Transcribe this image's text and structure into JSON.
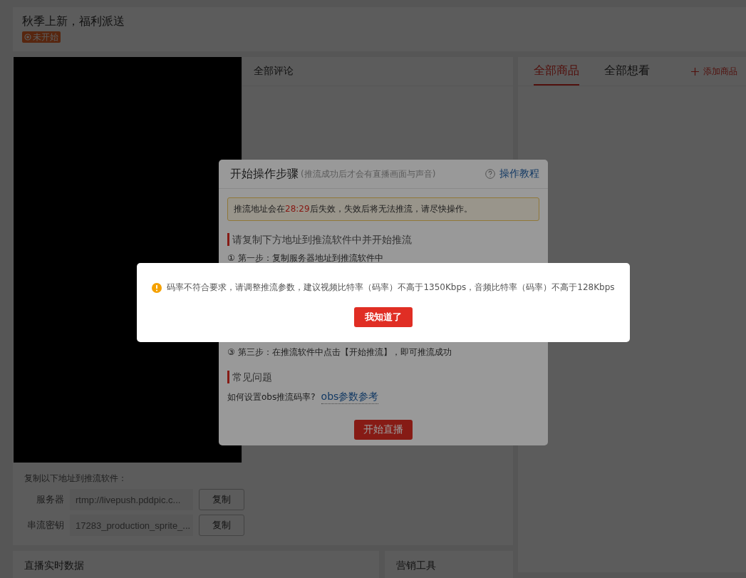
{
  "header": {
    "title": "秋季上新，福利派送",
    "status": "未开始"
  },
  "player": {
    "copy_hint": "复制以下地址到推流软件：",
    "fields": [
      {
        "label": "服务器",
        "value": "rtmp://livepush.pddpic.c...",
        "button": "复制"
      },
      {
        "label": "串流密钥",
        "value": "17283_production_sprite_...",
        "button": "复制"
      }
    ]
  },
  "comments": {
    "title": "全部评论"
  },
  "goods": {
    "tabs": [
      {
        "label": "全部商品",
        "selected": true
      },
      {
        "label": "全部想看",
        "selected": false
      }
    ],
    "add_button": "添加商品"
  },
  "bottom_panels": [
    {
      "title": "直播实时数据"
    },
    {
      "title": "营销工具"
    }
  ],
  "steps_dialog": {
    "title": "开始操作步骤",
    "subtitle": "(推流成功后才会有直播画面与声音)",
    "help_link": "操作教程",
    "notice_before": "推流地址会在",
    "countdown": "28:29",
    "notice_after": "后失效，失效后将无法推流，请尽快操作。",
    "section_1": "请复制下方地址到推流软件中并开始推流",
    "step_1": "① 第一步：复制服务器地址到推流软件中",
    "step_3": "③ 第三步：在推流软件中点击【开始推流】，即可推流成功",
    "section_2": "常见问题",
    "faq_question": "如何设置obs推流码率?",
    "faq_link": "obs参数参考",
    "start_button": "开始直播"
  },
  "alert": {
    "message": "码率不符合要求，请调整推流参数，建议视频比特率（码率）不高于1350Kbps，音频比特率（码率）不高于128Kbps",
    "button": "我知道了"
  }
}
